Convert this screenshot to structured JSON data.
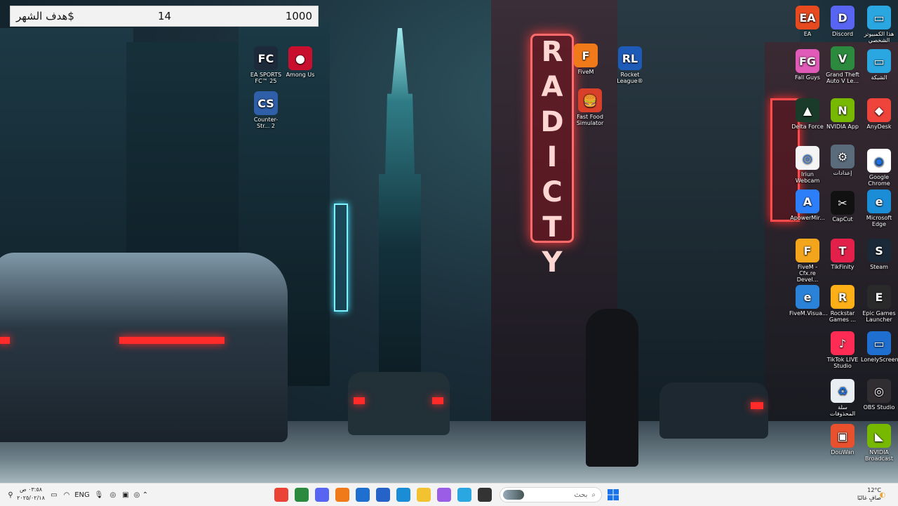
{
  "goal_widget": {
    "label": "هدف الشهر$",
    "current": "14",
    "target": "1000"
  },
  "wallpaper": {
    "neon_sign_text": "RADICTY"
  },
  "desktop_icons": [
    {
      "label": "EA SPORTS FC™ 25",
      "icon": "ea-fc-icon",
      "color": "#1c2a3a",
      "glyph": "FC"
    },
    {
      "label": "Among Us",
      "icon": "among-us-icon",
      "color": "#c8102e",
      "glyph": "●"
    },
    {
      "label": "Counter-Str... 2",
      "icon": "counter-strike-icon",
      "color": "#2f5fa8",
      "glyph": "CS"
    },
    {
      "label": "FiveM",
      "icon": "fivem-icon",
      "color": "#f07a1a",
      "glyph": "F"
    },
    {
      "label": "Rocket League®",
      "icon": "rocket-league-icon",
      "color": "#1e5bb8",
      "glyph": "RL"
    },
    {
      "label": "Fast Food Simulator",
      "icon": "fast-food-icon",
      "color": "#d8402a",
      "glyph": "🍔"
    },
    {
      "label": "EA",
      "icon": "ea-icon",
      "color": "#e84a1f",
      "glyph": "EA"
    },
    {
      "label": "Discord",
      "icon": "discord-icon",
      "color": "#5865f2",
      "glyph": "D"
    },
    {
      "label": "هذا الكمبيوتر الشخصي",
      "icon": "this-pc-icon",
      "color": "#2aa6e0",
      "glyph": "▭"
    },
    {
      "label": "Fall Guys",
      "icon": "fall-guys-icon",
      "color": "#e05ab7",
      "glyph": "FG"
    },
    {
      "label": "Grand Theft Auto V Le...",
      "icon": "gta-icon",
      "color": "#2b8a3e",
      "glyph": "V"
    },
    {
      "label": "الشبكة",
      "icon": "network-icon",
      "color": "#2aa6e0",
      "glyph": "▭"
    },
    {
      "label": "Delta Force",
      "icon": "delta-force-icon",
      "color": "#1a3a2a",
      "glyph": "▲"
    },
    {
      "label": "NVIDIA App",
      "icon": "nvidia-app-icon",
      "color": "#76b900",
      "glyph": "N"
    },
    {
      "label": "AnyDesk",
      "icon": "anydesk-icon",
      "color": "#ef443b",
      "glyph": "◆"
    },
    {
      "label": "Iriun Webcam",
      "icon": "iriun-webcam-icon",
      "color": "#f4f4f4",
      "glyph": "◎"
    },
    {
      "label": "إعدادات",
      "icon": "settings-icon",
      "color": "#5a6b7b",
      "glyph": "⚙"
    },
    {
      "label": "Google Chrome",
      "icon": "chrome-icon",
      "color": "#ffffff",
      "glyph": "◉"
    },
    {
      "label": "ApowerMir...",
      "icon": "apowermirror-icon",
      "color": "#2d7ff9",
      "glyph": "A"
    },
    {
      "label": "CapCut",
      "icon": "capcut-icon",
      "color": "#111111",
      "glyph": "✂"
    },
    {
      "label": "Microsoft Edge",
      "icon": "edge-icon",
      "color": "#1b8cd6",
      "glyph": "e"
    },
    {
      "label": "FiveM - Cfx.re Devel...",
      "icon": "fivem-dev-icon",
      "color": "#f3a51c",
      "glyph": "F"
    },
    {
      "label": "TikFinity",
      "icon": "tikfinity-icon",
      "color": "#e2204a",
      "glyph": "T"
    },
    {
      "label": "Steam",
      "icon": "steam-icon",
      "color": "#1b2838",
      "glyph": "S"
    },
    {
      "label": "FiveM.Visua...",
      "icon": "fivem-visual-icon",
      "color": "#2a83d9",
      "glyph": "e"
    },
    {
      "label": "Rockstar Games ...",
      "icon": "rockstar-icon",
      "color": "#fcaf17",
      "glyph": "R"
    },
    {
      "label": "Epic Games Launcher",
      "icon": "epic-games-icon",
      "color": "#2a2a2a",
      "glyph": "E"
    },
    {
      "label": "TikTok LIVE Studio",
      "icon": "tiktok-live-icon",
      "color": "#fe2c55",
      "glyph": "♪"
    },
    {
      "label": "LonelyScreen",
      "icon": "lonelyscreen-icon",
      "color": "#1f6fd1",
      "glyph": "▭"
    },
    {
      "label": "سلة المحذوفات",
      "icon": "recycle-bin-icon",
      "color": "#e8eef2",
      "glyph": "♻"
    },
    {
      "label": "OBS Studio",
      "icon": "obs-icon",
      "color": "#302e31",
      "glyph": "◎"
    },
    {
      "label": "DouWan",
      "icon": "douwan-icon",
      "color": "#e8502e",
      "glyph": "▣"
    },
    {
      "label": "NVIDIA Broadcast",
      "icon": "nvidia-broadcast-icon",
      "color": "#76b900",
      "glyph": "◣"
    }
  ],
  "taskbar": {
    "time": "٠٣:٥٨ ص",
    "date": "٢٠٢٥/٠٢/١٨",
    "language": "ENG",
    "search_placeholder": "بحث",
    "weather_temp": "12°C",
    "weather_desc": "صافٍ غالبًا",
    "apps": [
      {
        "name": "chrome-taskbar-icon",
        "color": "#ea4335"
      },
      {
        "name": "terminal-taskbar-icon",
        "color": "#2b8a3e"
      },
      {
        "name": "discord-taskbar-icon",
        "color": "#5865f2"
      },
      {
        "name": "fivem-taskbar-icon",
        "color": "#f07a1a"
      },
      {
        "name": "vscode-taskbar-icon",
        "color": "#1f6fd1"
      },
      {
        "name": "store-taskbar-icon",
        "color": "#2563c9"
      },
      {
        "name": "edge-taskbar-icon",
        "color": "#1b8cd6"
      },
      {
        "name": "file-explorer-taskbar-icon",
        "color": "#f2c230"
      },
      {
        "name": "copilot-taskbar-icon",
        "color": "#9b5de5"
      },
      {
        "name": "photos-taskbar-icon",
        "color": "#2aa6e0"
      },
      {
        "name": "console-taskbar-icon",
        "color": "#333333"
      }
    ]
  }
}
